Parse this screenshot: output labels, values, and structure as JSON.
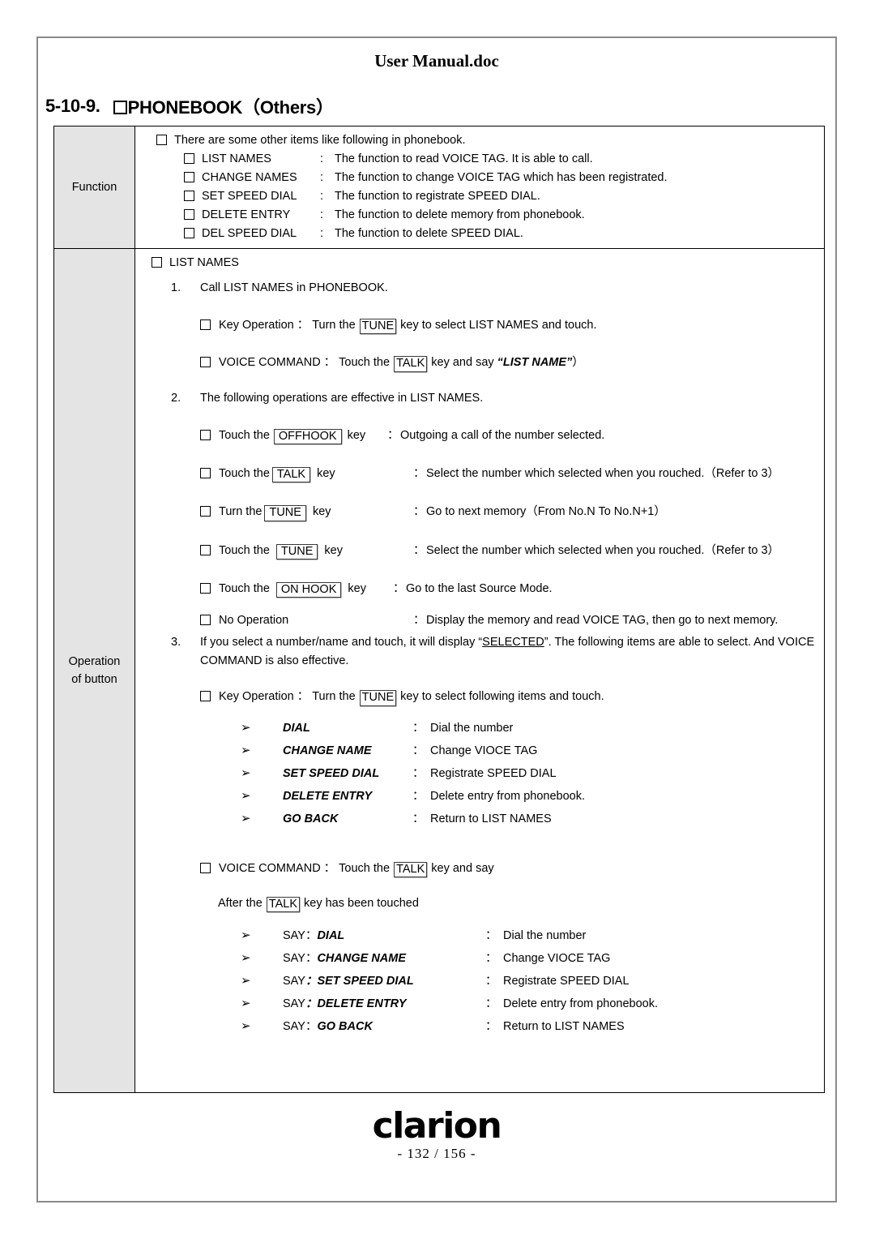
{
  "header": {
    "doc_title": "User Manual.doc"
  },
  "section": {
    "number": "5-10-9.",
    "title": "PHONEBOOK（Others）"
  },
  "table": {
    "rows": [
      {
        "label": "Function"
      },
      {
        "label_line1": "Operation",
        "label_line2": "of button"
      }
    ]
  },
  "function": {
    "intro": "There are some other items like following in phonebook.",
    "items": [
      {
        "name": "LIST NAMES",
        "colon": ":",
        "desc": "The function to read VOICE TAG.  It is able to call."
      },
      {
        "name": "CHANGE NAMES",
        "colon": ":",
        "desc": "The function to change VOICE TAG which has been registrated."
      },
      {
        "name": "SET SPEED DIAL",
        "colon": ":",
        "desc": "The function to registrate SPEED DIAL."
      },
      {
        "name": "DELETE ENTRY",
        "colon": ":",
        "desc": "The function to delete memory from phonebook."
      },
      {
        "name": "DEL SPEED DIAL",
        "colon": ":",
        "desc": "The function to delete SPEED DIAL."
      }
    ]
  },
  "operation": {
    "heading": "LIST NAMES",
    "step1": {
      "num": "1.",
      "text": "Call LIST NAMES in PHONEBOOK.",
      "key_operation": {
        "label": "Key Operation",
        "colon": "：",
        "before": "Turn the",
        "key": "TUNE",
        "after": "key to select LIST NAMES and touch."
      },
      "voice_command": {
        "label": "VOICE COMMAND",
        "colon": "：",
        "before": "Touch the",
        "key": "TALK",
        "after": "key and say",
        "phrase": "“LIST NAME”",
        "trailing": "）"
      }
    },
    "step2": {
      "num": "2.",
      "text": "The following operations are effective in LIST NAMES.",
      "rows": [
        {
          "action": "Touch the",
          "key": "OFFHOOK",
          "key_wide": true,
          "tail": "key",
          "colon": "：",
          "desc": "Outgoing a call of the number selected."
        },
        {
          "action": "Touch the",
          "key": "TALK",
          "key_wide": true,
          "tail": "key",
          "colon": "：",
          "desc": "Select the number which selected when you rouched.（Refer to 3）"
        },
        {
          "action": "Turn the",
          "key": "TUNE",
          "key_wide": true,
          "tail": "key",
          "colon": "：",
          "desc": "Go to next memory（From No.N  To  No.N+1）"
        },
        {
          "action": "Touch the",
          "key": "TUNE",
          "key_wide": true,
          "tail": "key",
          "colon": "：",
          "desc": "Select the number which selected when you rouched.（Refer to 3）"
        },
        {
          "action": "Touch the",
          "key": "ON HOOK",
          "key_wide": true,
          "tail": "key",
          "colon": "：",
          "desc": "Go to the last Source Mode."
        },
        {
          "action": "No Operation",
          "key": "",
          "key_wide": false,
          "tail": "",
          "colon": "：",
          "desc": "Display the memory and read VOICE TAG, then go to next memory."
        }
      ]
    },
    "step3": {
      "num": "3.",
      "text_before": "If you select a number/name and touch, it will display “",
      "underlined": "SELECTED",
      "text_after": "”. The following items are able to select. And VOICE COMMAND is also effective.",
      "key_operation": {
        "label": "Key Operation",
        "colon": "：",
        "before": "Turn the",
        "key": "TUNE",
        "after": "key to select following items and touch."
      },
      "dial_list": [
        {
          "bullet": "➢",
          "name": "DIAL",
          "colon": "：",
          "desc": "Dial the number"
        },
        {
          "bullet": "➢",
          "name": "CHANGE NAME",
          "colon": "：",
          "desc": "Change VIOCE TAG"
        },
        {
          "bullet": "➢",
          "name": "SET SPEED DIAL",
          "colon": "：",
          "desc": "Registrate SPEED DIAL"
        },
        {
          "bullet": "➢",
          "name": "DELETE ENTRY",
          "colon": "：",
          "desc": "Delete entry from phonebook."
        },
        {
          "bullet": "➢",
          "name": "GO BACK",
          "colon": "：",
          "desc": "Return to LIST NAMES"
        }
      ],
      "voice_command": {
        "label": "VOICE COMMAND",
        "colon": "：",
        "before": "Touch the",
        "key": "TALK",
        "after": "key and say"
      },
      "after_talk": {
        "before": "After the",
        "key": "TALK",
        "after": "key has been touched"
      },
      "say_list": [
        {
          "bullet": "➢",
          "prefix": "SAY：",
          "name": "DIAL",
          "colon": "：",
          "desc": "Dial the number"
        },
        {
          "bullet": "➢",
          "prefix": "SAY：",
          "name": "CHANGE NAME",
          "colon": "：",
          "desc": "Change VIOCE TAG"
        },
        {
          "bullet": "➢",
          "prefix": "SAY",
          "name": "：SET SPEED DIAL",
          "colon": "：",
          "desc": "Registrate SPEED DIAL"
        },
        {
          "bullet": "➢",
          "prefix": "SAY",
          "name": "：DELETE ENTRY",
          "colon": "：",
          "desc": "Delete entry from phonebook."
        },
        {
          "bullet": "➢",
          "prefix": "SAY：",
          "name": "GO BACK",
          "colon": "：",
          "desc": "Return to LIST NAMES"
        }
      ]
    }
  },
  "footer": {
    "brand": "clarion",
    "page_number": "- 132 / 156 -"
  }
}
